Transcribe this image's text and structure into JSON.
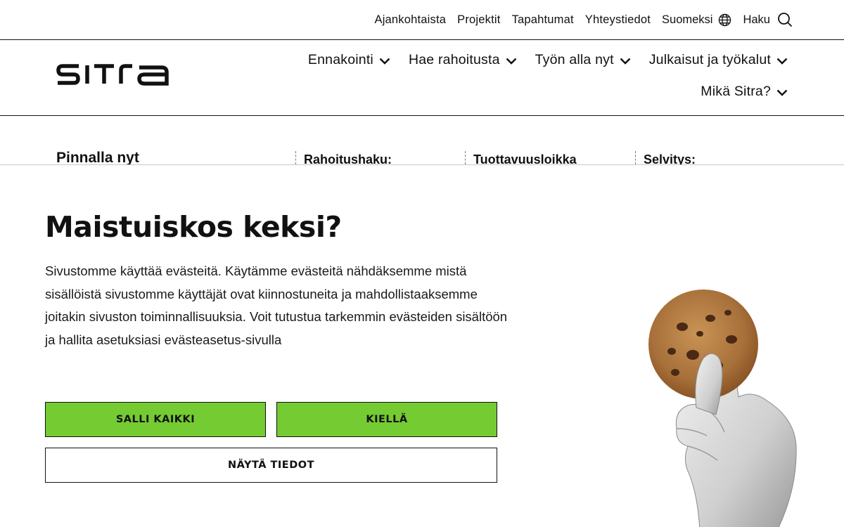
{
  "topbar": {
    "links": [
      "Ajankohtaista",
      "Projektit",
      "Tapahtumat",
      "Yhteystiedot"
    ],
    "language": "Suomeksi",
    "search": "Haku"
  },
  "header": {
    "logo_text": "SITRA",
    "nav": [
      "Ennakointi",
      "Hae rahoitusta",
      "Työn alla nyt",
      "Julkaisut ja työkalut",
      "Mikä Sitra?"
    ]
  },
  "strip": {
    "title": "Pinnalla nyt",
    "items": [
      "Rahoitushaku:",
      "Tuottavuusloikka",
      "Selvitys:"
    ]
  },
  "cookie_modal": {
    "title": "Maistuiskos keksi?",
    "body": "Sivustomme käyttää evästeitä. Käytämme evästeitä nähdäksemme mistä sisällöistä sivustomme käyttäjät ovat kiinnostuneita ja mahdollistaaksemme joitakin sivuston toiminnallisuuksia. Voit tutustua tarkemmin evästeiden sisältöön ja hallita asetuksiasi evästeasetus-sivulla",
    "allow_all": "SALLI KAIKKI",
    "deny": "KIELLÄ",
    "show_details": "NÄYTÄ TIEDOT"
  },
  "colors": {
    "accent_green": "#74cb32",
    "text": "#111111"
  },
  "icons": [
    "globe-icon",
    "search-icon",
    "chevron-down-icon",
    "cookie-hand-image"
  ]
}
